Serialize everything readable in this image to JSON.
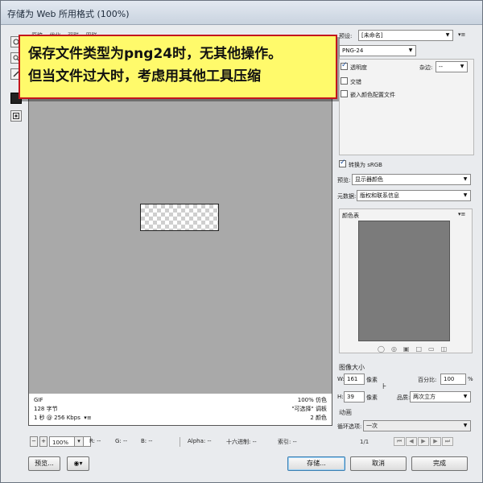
{
  "window": {
    "title": "存储为 Web 所用格式 (100%)"
  },
  "annotation": {
    "line1": "保存文件类型为png24时，无其他操作。",
    "line2": "但当文件过大时，考虑用其他工具压缩"
  },
  "preview_tabs": [
    "原稿",
    "优化",
    "双联",
    "四联"
  ],
  "info": {
    "format": "GIF",
    "size": "128 字节",
    "time": "1 秒 @ 256 Kbps",
    "dither": "100% 仿色",
    "palette": "\"可选择\" 调板",
    "colors": "2 颜色"
  },
  "status": {
    "zoom": "100%",
    "r": "R: --",
    "g": "G: --",
    "b": "B: --",
    "alpha": "Alpha: --",
    "hex": "十六进制: --",
    "index": "索引: --"
  },
  "footer": {
    "preview_label": "预览...",
    "save_label": "存储...",
    "cancel_label": "取消",
    "done_label": "完成"
  },
  "settings": {
    "preset_label": "预设:",
    "preset_value": "[未命名]",
    "format_value": "PNG-24",
    "transparency_label": "透明度",
    "transparency_checked": true,
    "matte_label": "杂边:",
    "matte_value": "--",
    "interlaced_label": "交错",
    "interlaced_checked": false,
    "embed_profile_label": "嵌入颜色配置文件",
    "embed_profile_checked": false,
    "convert_srgb_label": "转换为 sRGB",
    "convert_srgb_checked": true,
    "preview_label": "预览:",
    "preview_value": "显示器颜色",
    "metadata_label": "元数据:",
    "metadata_value": "版权和联系信息",
    "color_table_label": "颜色表",
    "image_size_label": "图像大小",
    "width_label": "W:",
    "width_value": "161",
    "height_label": "H:",
    "height_value": "39",
    "pixels_label": "像素",
    "percent_label": "百分比:",
    "percent_value": "100",
    "percent_unit": "%",
    "quality_label": "品质:",
    "quality_value": "两次立方",
    "animation_label": "动画",
    "loop_label": "循环选项:",
    "loop_value": "一次",
    "frame_counter": "1/1"
  }
}
